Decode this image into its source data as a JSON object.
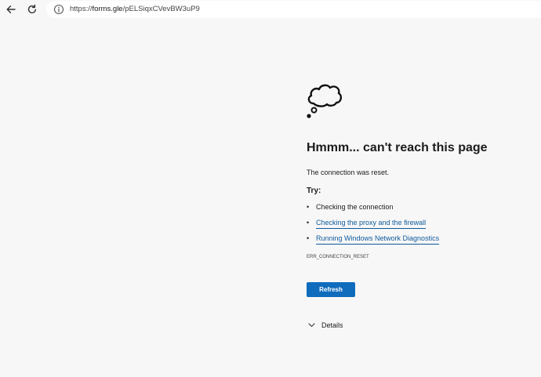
{
  "browser": {
    "url_prefix": "https://",
    "url_domain": "forms.gle",
    "url_path": "/pELSiqxCVevBW3uP9",
    "icons": {
      "back": "arrow-left-icon",
      "reload": "refresh-icon",
      "site_info": "info-icon"
    }
  },
  "error_page": {
    "icon": "thought-cloud-icon",
    "title": "Hmmm... can't reach this page",
    "description": "The connection was reset.",
    "try_heading": "Try:",
    "suggestions": [
      {
        "label": "Checking the connection",
        "is_link": false
      },
      {
        "label": "Checking the proxy and the firewall",
        "is_link": true
      },
      {
        "label": "Running Windows Network Diagnostics",
        "is_link": true
      }
    ],
    "error_code": "ERR_CONNECTION_RESET",
    "refresh_label": "Refresh",
    "details_label": "Details",
    "colors": {
      "accent": "#0f6cbd",
      "link": "#0e5a9c",
      "background": "#f7f7f7"
    }
  }
}
